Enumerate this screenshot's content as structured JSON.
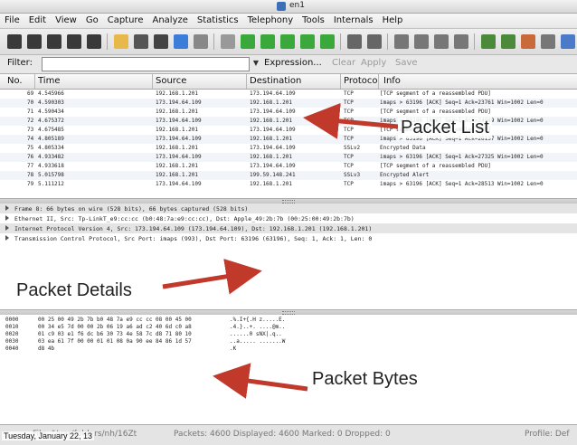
{
  "window": {
    "title": "en1"
  },
  "menu": [
    "File",
    "Edit",
    "View",
    "Go",
    "Capture",
    "Analyze",
    "Statistics",
    "Telephony",
    "Tools",
    "Internals",
    "Help"
  ],
  "toolbar": {
    "buttons": [
      "interface-list",
      "capture-options",
      "start-capture",
      "stop-capture",
      "restart-capture",
      "open-file",
      "save-file",
      "close-file",
      "reload-file",
      "print",
      "find-packet",
      "go-back",
      "go-forward",
      "go-to-packet",
      "go-first",
      "go-last",
      "colorize",
      "auto-scroll",
      "zoom-in",
      "zoom-out",
      "normal-size",
      "resize-columns",
      "capture-filters",
      "display-filters",
      "coloring-rules",
      "preferences",
      "help"
    ]
  },
  "filter": {
    "label": "Filter:",
    "value": "",
    "expression_label": "Expression...",
    "clear_label": "Clear",
    "apply_label": "Apply",
    "save_label": "Save"
  },
  "packet_list": {
    "columns": [
      "No.",
      "Time",
      "Source",
      "Destination",
      "Protoco",
      "Info"
    ],
    "rows": [
      {
        "no": "69",
        "time": "4.545966",
        "src": "192.168.1.201",
        "dst": "173.194.64.109",
        "proto": "TCP",
        "info": "[TCP segment of a reassembled PDU]"
      },
      {
        "no": "70",
        "time": "4.590303",
        "src": "173.194.64.109",
        "dst": "192.168.1.201",
        "proto": "TCP",
        "info": "imaps > 63196 [ACK] Seq=1 Ack=23761 Win=1002 Len=0"
      },
      {
        "no": "71",
        "time": "4.590434",
        "src": "192.168.1.201",
        "dst": "173.194.64.109",
        "proto": "TCP",
        "info": "[TCP segment of a reassembled PDU]"
      },
      {
        "no": "72",
        "time": "4.675372",
        "src": "173.194.64.109",
        "dst": "192.168.1.201",
        "proto": "TCP",
        "info": "imaps > 63196 [ACK] Seq=1 Ack=24949 Win=1002 Len=0"
      },
      {
        "no": "73",
        "time": "4.675485",
        "src": "192.168.1.201",
        "dst": "173.194.64.109",
        "proto": "TCP",
        "info": "[TCP segment of a reassembled PDU]"
      },
      {
        "no": "74",
        "time": "4.805189",
        "src": "173.194.64.109",
        "dst": "192.168.1.201",
        "proto": "TCP",
        "info": "imaps > 63196 [ACK] Seq=1 Ack=26137 Win=1002 Len=0"
      },
      {
        "no": "75",
        "time": "4.805334",
        "src": "192.168.1.201",
        "dst": "173.194.64.109",
        "proto": "SSLv2",
        "info": "Encrypted Data"
      },
      {
        "no": "76",
        "time": "4.933482",
        "src": "173.194.64.109",
        "dst": "192.168.1.201",
        "proto": "TCP",
        "info": "imaps > 63196 [ACK] Seq=1 Ack=27325 Win=1002 Len=0"
      },
      {
        "no": "77",
        "time": "4.933618",
        "src": "192.168.1.201",
        "dst": "173.194.64.109",
        "proto": "TCP",
        "info": "[TCP segment of a reassembled PDU]"
      },
      {
        "no": "78",
        "time": "5.015798",
        "src": "192.168.1.201",
        "dst": "199.59.148.241",
        "proto": "SSLv3",
        "info": "Encrypted Alert"
      },
      {
        "no": "79",
        "time": "5.111212",
        "src": "173.194.64.109",
        "dst": "192.168.1.201",
        "proto": "TCP",
        "info": "imaps > 63196 [ACK] Seq=1 Ack=28513 Win=1002 Len=0"
      }
    ]
  },
  "packet_details": [
    "Frame 8: 66 bytes on wire (528 bits), 66 bytes captured (528 bits)",
    "Ethernet II, Src: Tp-LinkT_e9:cc:cc (b0:48:7a:e9:cc:cc), Dst: Apple_49:2b:7b (00:25:00:49:2b:7b)",
    "Internet Protocol Version 4, Src: 173.194.64.109 (173.194.64.109), Dst: 192.168.1.201 (192.168.1.201)",
    "Transmission Control Protocol, Src Port: imaps (993), Dst Port: 63196 (63196), Seq: 1, Ack: 1, Len: 0"
  ],
  "packet_bytes": [
    {
      "offset": "0000",
      "hex": "00 25 00 49 2b 7b b0 48  7a e9 cc cc 08 00 45 00",
      "ascii": ".%.I+{.H z.....E."
    },
    {
      "offset": "0010",
      "hex": "00 34 e5 7d 00 00 2b 06  19 a6 ad c2 40 6d c0 a8",
      "ascii": ".4.}..+. ....@m.."
    },
    {
      "offset": "0020",
      "hex": "01 c9 03 e1 f6 dc b6 30  73 4e 58 7c d8 71 80 10",
      "ascii": "......0 sNX|.q.."
    },
    {
      "offset": "0030",
      "hex": "03 ea 61 7f 00 00 01 01  08 0a 90 ee 84 86 1d 57",
      "ascii": "..a..... .......W"
    },
    {
      "offset": "0040",
      "hex": "d8 4b",
      "ascii": ".K"
    }
  ],
  "status": {
    "file": "File: \"/var/folders/nh/16Zt",
    "packets": "Packets: 4600 Displayed: 4600 Marked: 0 Dropped: 0",
    "profile": "Profile: Def"
  },
  "annotations": {
    "packet_list": "Packet List",
    "packet_details": "Packet Details",
    "packet_bytes": "Packet Bytes",
    "date": "Tuesday, January 22, 13"
  },
  "colors": {
    "arrow": "#c0392b"
  }
}
